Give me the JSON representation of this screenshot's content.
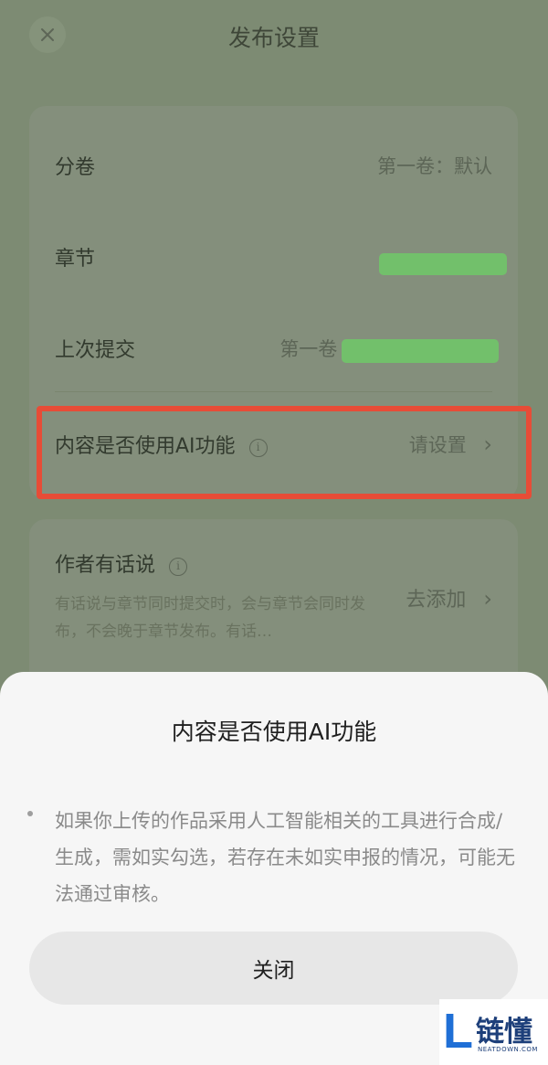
{
  "header": {
    "close_icon": "close-icon",
    "title": "发布设置"
  },
  "settings": {
    "volume": {
      "label": "分卷",
      "value": "第一卷：默认"
    },
    "chapter": {
      "label": "章节",
      "value": ""
    },
    "last_submit": {
      "label": "上次提交",
      "value": "第一卷 第"
    },
    "ai_usage": {
      "label": "内容是否使用AI功能",
      "info_icon": "info-icon",
      "value": "请设置",
      "chevron": "›"
    }
  },
  "author_note": {
    "title": "作者有话说",
    "info_icon": "info-icon",
    "description": "有话说与章节同时提交时，会与章节会同时发布，不会晚于章节发布。有话…",
    "action": "去添加",
    "chevron": "›"
  },
  "sheet": {
    "title": "内容是否使用AI功能",
    "body": "如果你上传的作品采用人工智能相关的工具进行合成/生成，需如实勾选，若存在未如实申报的情况，可能无法通过审核。",
    "close_label": "关闭"
  },
  "watermark": {
    "logo_letter": "L",
    "text": "链懂",
    "url": "NEATDOWN.COM"
  },
  "colors": {
    "highlight": "#e74c37",
    "redaction": "#72c06b",
    "overlay": "#7d8b73"
  }
}
